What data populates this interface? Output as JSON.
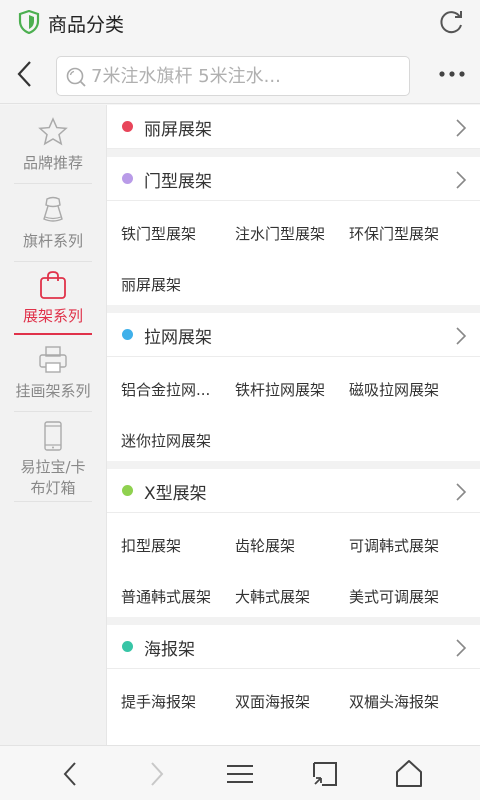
{
  "window": {
    "title": "商品分类"
  },
  "search": {
    "placeholder": "7米注水旗杆 5米注水..."
  },
  "sidebar": {
    "items": [
      {
        "label": "品牌推荐",
        "icon": "star-icon",
        "active": false
      },
      {
        "label": "旗杆系列",
        "icon": "flag-banner-icon",
        "active": false
      },
      {
        "label": "展架系列",
        "icon": "shopping-bag-icon",
        "active": true
      },
      {
        "label": "挂画架系列",
        "icon": "printer-icon",
        "active": false
      },
      {
        "label": "易拉宝/卡布灯箱",
        "icon": "phone-icon",
        "active": false
      }
    ]
  },
  "sections": [
    {
      "title": "丽屏展架",
      "dot_color": "#e8455a",
      "items": []
    },
    {
      "title": "门型展架",
      "dot_color": "#b99be8",
      "items": [
        "铁门型展架",
        "注水门型展架",
        "环保门型展架",
        "丽屏展架"
      ]
    },
    {
      "title": "拉网展架",
      "dot_color": "#3fb0ea",
      "items": [
        "铝合金拉网...",
        "铁杆拉网展架",
        "磁吸拉网展架",
        "迷你拉网展架"
      ]
    },
    {
      "title": "X型展架",
      "dot_color": "#8fd14f",
      "items": [
        "扣型展架",
        "齿轮展架",
        "可调韩式展架",
        "普通韩式展架",
        "大韩式展架",
        "美式可调展架"
      ]
    },
    {
      "title": "海报架",
      "dot_color": "#37c5a6",
      "items": [
        "提手海报架",
        "双面海报架",
        "双楣头海报架"
      ]
    }
  ],
  "colors": {
    "accent": "#e0324a",
    "shield": "#4caf50"
  },
  "bottombar": {
    "icons": [
      "back-arrow-icon",
      "forward-arrow-icon",
      "menu-icon",
      "tabs-icon",
      "home-icon"
    ]
  }
}
